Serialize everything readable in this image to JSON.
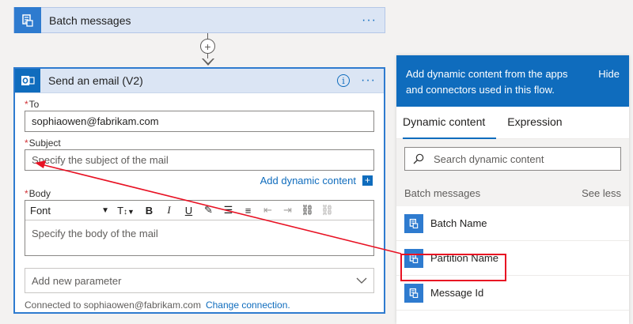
{
  "trigger": {
    "title": "Batch messages",
    "more": "···"
  },
  "connector": {
    "plus": "+"
  },
  "email_card": {
    "title": "Send an email (V2)",
    "info": "i",
    "more": "···",
    "to": {
      "label": "To",
      "value": "sophiaowen@fabrikam.com"
    },
    "subject": {
      "label": "Subject",
      "placeholder": "Specify the subject of the mail"
    },
    "add_dynamic": "Add dynamic content",
    "body": {
      "label": "Body",
      "font": "Font",
      "placeholder": "Specify the body of the mail"
    },
    "add_param": "Add new parameter",
    "footer": {
      "connected": "Connected to sophiaowen@fabrikam.com",
      "change": "Change connection."
    },
    "required_mark": "*"
  },
  "panel": {
    "header": "Add dynamic content from the apps and connectors used in this flow.",
    "hide": "Hide",
    "tabs": [
      "Dynamic content",
      "Expression"
    ],
    "search_placeholder": "Search dynamic content",
    "group": {
      "name": "Batch messages",
      "see_less": "See less"
    },
    "items": [
      "Batch Name",
      "Partition Name",
      "Message Id"
    ]
  },
  "colors": {
    "accent": "#0f6cbd",
    "highlight": "#e81123",
    "icon_bg": "#2e7bcf"
  }
}
